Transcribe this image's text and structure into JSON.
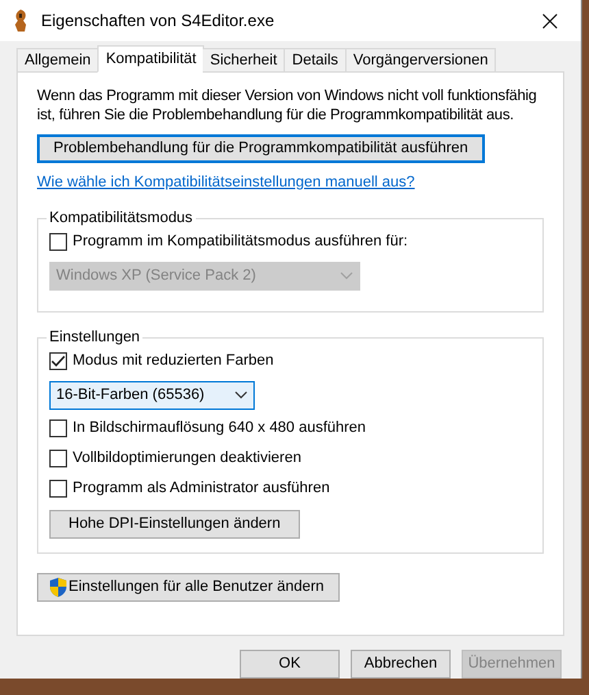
{
  "window": {
    "title": "Eigenschaften von S4Editor.exe"
  },
  "tabs": [
    {
      "label": "Allgemein",
      "selected": false
    },
    {
      "label": "Kompatibilität",
      "selected": true
    },
    {
      "label": "Sicherheit",
      "selected": false
    },
    {
      "label": "Details",
      "selected": false
    },
    {
      "label": "Vorgängerversionen",
      "selected": false
    }
  ],
  "intro": "Wenn das Programm mit dieser Version von Windows nicht voll funktionsfähig ist, führen Sie die Problembehandlung für die Programmkompatibilität aus.",
  "troubleshoot_button": {
    "label": "Problembehandlung für die Programmkompatibilität ausführen",
    "focused": true
  },
  "manual_link": "Wie wähle ich Kompatibilitätseinstellungen manuell aus?",
  "compat_mode": {
    "title": "Kompatibilitätsmodus",
    "items": [
      {
        "kind": "checkbox",
        "label": "Programm im Kompatibilitätsmodus ausführen für:",
        "checked": false
      },
      {
        "kind": "dropdown",
        "value": "Windows XP (Service Pack 2)",
        "disabled": true
      }
    ]
  },
  "settings": {
    "title": "Einstellungen",
    "items": [
      {
        "kind": "checkbox",
        "label": "Modus mit reduzierten Farben",
        "checked": true
      },
      {
        "kind": "dropdown",
        "value": "16-Bit-Farben (65536)",
        "disabled": false,
        "hovered": true
      },
      {
        "kind": "checkbox",
        "label": "In Bildschirmauflösung 640 x 480 ausführen",
        "checked": false
      },
      {
        "kind": "checkbox",
        "label": "Vollbildoptimierungen deaktivieren",
        "checked": false
      },
      {
        "kind": "checkbox",
        "label": "Programm als Administrator ausführen",
        "checked": false
      },
      {
        "kind": "button",
        "label": "Hohe DPI-Einstellungen ändern"
      }
    ]
  },
  "all_users_button": {
    "label": "Einstellungen für alle Benutzer ändern"
  },
  "footer_buttons": [
    {
      "label": "OK",
      "disabled": false
    },
    {
      "label": "Abbrechen",
      "disabled": false
    },
    {
      "label": "Übernehmen",
      "disabled": true
    }
  ]
}
